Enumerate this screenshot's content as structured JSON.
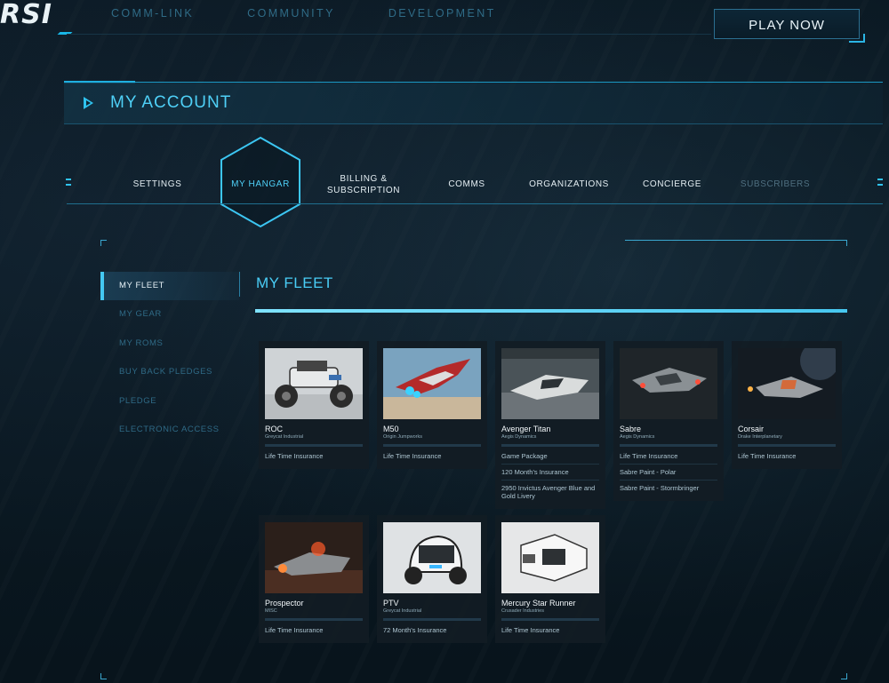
{
  "brand": {
    "logo": "RSI"
  },
  "topnav": {
    "items": [
      "COMM-LINK",
      "COMMUNITY",
      "DEVELOPMENT"
    ],
    "play_label": "PLAY NOW"
  },
  "account": {
    "title": "MY ACCOUNT"
  },
  "tabs": [
    {
      "label": "SETTINGS",
      "state": "normal"
    },
    {
      "label": "MY HANGAR",
      "state": "active"
    },
    {
      "label": "BILLING &\nSUBSCRIPTION",
      "state": "normal"
    },
    {
      "label": "COMMS",
      "state": "normal"
    },
    {
      "label": "ORGANIZATIONS",
      "state": "normal"
    },
    {
      "label": "CONCIERGE",
      "state": "normal"
    },
    {
      "label": "SUBSCRIBERS",
      "state": "disabled"
    }
  ],
  "sidebar": {
    "items": [
      {
        "label": "MY FLEET",
        "active": true
      },
      {
        "label": "MY GEAR",
        "active": false
      },
      {
        "label": "MY ROMS",
        "active": false
      },
      {
        "label": "BUY BACK PLEDGES",
        "active": false
      },
      {
        "label": "PLEDGE",
        "active": false
      },
      {
        "label": "ELECTRONIC ACCESS",
        "active": false
      }
    ]
  },
  "fleet": {
    "title": "MY FLEET",
    "ships": [
      {
        "name": "ROC",
        "maker": "Greycat Industrial",
        "thumb": "vehicle-rover",
        "items": [
          "Life Time Insurance"
        ]
      },
      {
        "name": "M50",
        "maker": "Origin Jumpworks",
        "thumb": "racer-red",
        "items": [
          "Life Time Insurance"
        ]
      },
      {
        "name": "Avenger Titan",
        "maker": "Aegis Dynamics",
        "thumb": "ship-hangar-white",
        "items": [
          "Game Package",
          "120 Month's Insurance",
          "2950 Invictus Avenger Blue and Gold Livery"
        ]
      },
      {
        "name": "Sabre",
        "maker": "Aegis Dynamics",
        "thumb": "fighter-dark",
        "items": [
          "Life Time Insurance",
          "Sabre Paint - Polar",
          "Sabre Paint - Stormbringer"
        ]
      },
      {
        "name": "Corsair",
        "maker": "Drake Interplanetary",
        "thumb": "ship-space",
        "items": [
          "Life Time Insurance"
        ]
      },
      {
        "name": "Prospector",
        "maker": "MISC",
        "thumb": "miner-orange",
        "items": [
          "Life Time Insurance"
        ]
      },
      {
        "name": "PTV",
        "maker": "Greycat Industrial",
        "thumb": "buggy-white",
        "items": [
          "72 Month's Insurance"
        ]
      },
      {
        "name": "Mercury Star Runner",
        "maker": "Crusader Industries",
        "thumb": "ship-topdown-white",
        "items": [
          "Life Time Insurance"
        ]
      }
    ]
  },
  "colors": {
    "accent": "#4fd0f7",
    "bright_line": "#7fe3ff",
    "background": "#07121a",
    "card": "#121c24"
  }
}
